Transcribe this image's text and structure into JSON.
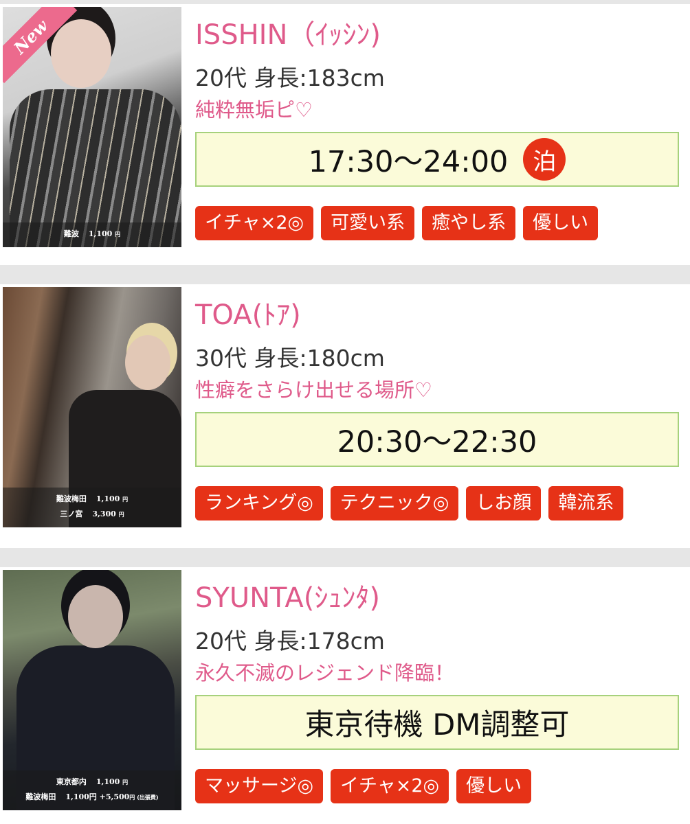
{
  "casts": [
    {
      "name": "ISSHIN（ｲｯｼﾝ)",
      "spec": "20代 身長:183cm",
      "catchphrase": "純粋無垢ピ♡",
      "schedule": "17:30〜24:00",
      "stay_badge": "泊",
      "new_badge": "New",
      "prices": [
        {
          "area": "難波",
          "price": "1,100",
          "unit": "円"
        }
      ],
      "tags": [
        "イチャ×2◎",
        "可愛い系",
        "癒やし系",
        "優しい"
      ]
    },
    {
      "name": "TOA(ﾄｱ)",
      "spec": "30代 身長:180cm",
      "catchphrase": "性癖をさらけ出せる場所♡",
      "schedule": "20:30〜22:30",
      "prices": [
        {
          "area": "難波梅田",
          "price": "1,100",
          "unit": "円"
        },
        {
          "area": "三ノ宮",
          "price": "3,300",
          "unit": "円"
        }
      ],
      "tags": [
        "ランキング◎",
        "テクニック◎",
        "しお顔",
        "韓流系"
      ]
    },
    {
      "name": "SYUNTA(ｼｭﾝﾀ)",
      "spec": "20代 身長:178cm",
      "catchphrase": "永久不滅のレジェンド降臨！",
      "schedule": "東京待機 DM調整可",
      "prices": [
        {
          "area": "東京都内",
          "price": "1,100",
          "unit": "円"
        },
        {
          "area": "難波梅田",
          "price": "1,100円 +5,500",
          "unit": "円 (出張費)"
        }
      ],
      "tags": [
        "マッサージ◎",
        "イチャ×2◎",
        "優しい"
      ]
    }
  ]
}
